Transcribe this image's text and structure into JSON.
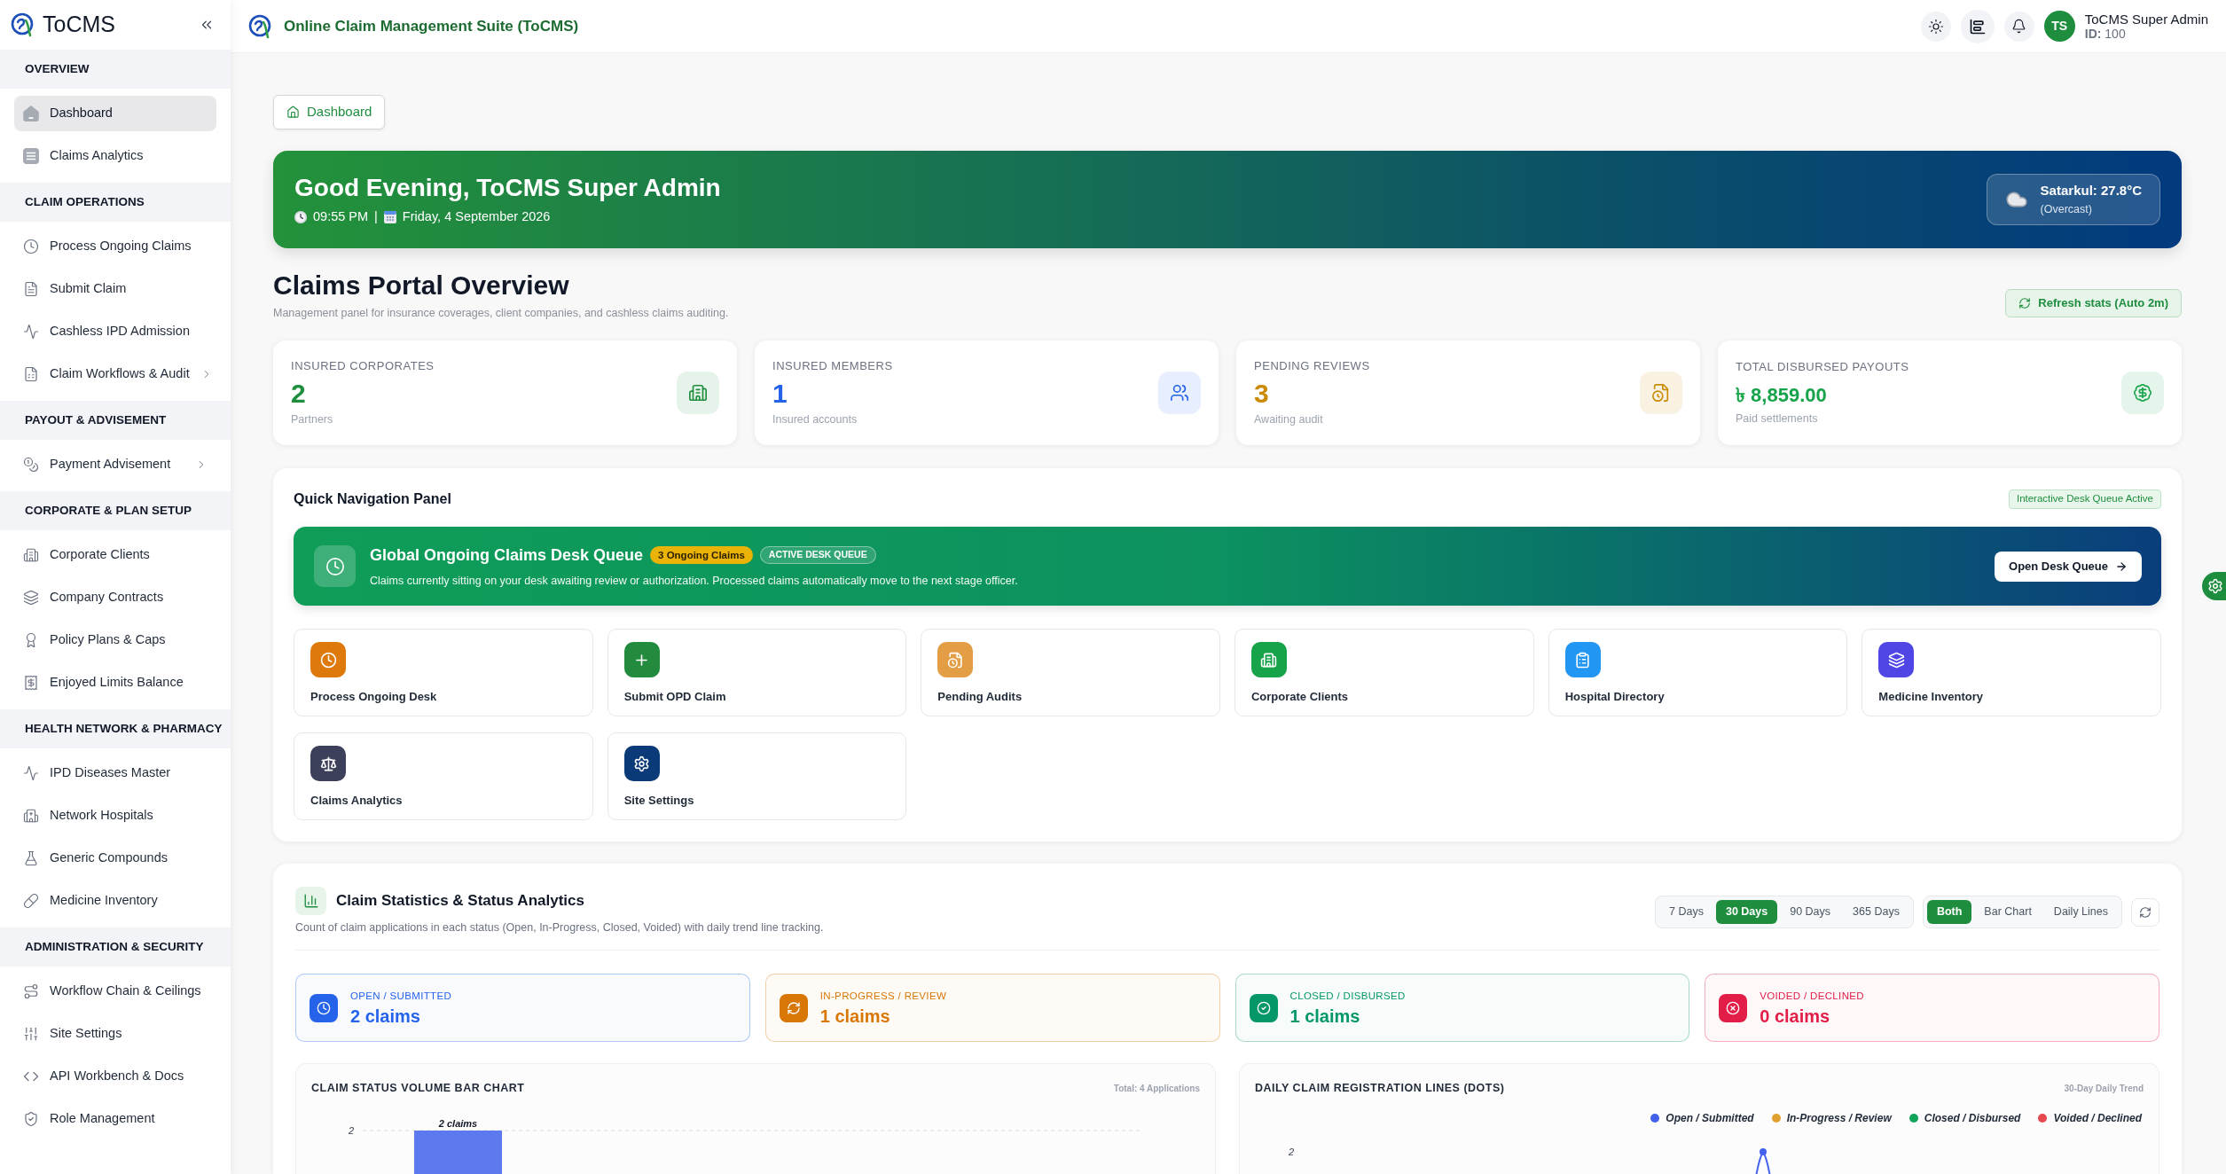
{
  "sidebar": {
    "brand": "ToCMS",
    "sections": [
      {
        "title": "OVERVIEW",
        "items": [
          {
            "label": "Dashboard",
            "selected": true,
            "expandable": false
          },
          {
            "label": "Claims Analytics",
            "selected": false,
            "expandable": false
          }
        ]
      },
      {
        "title": "CLAIM OPERATIONS",
        "items": [
          {
            "label": "Process Ongoing Claims",
            "selected": false,
            "expandable": false
          },
          {
            "label": "Submit Claim",
            "selected": false,
            "expandable": false
          },
          {
            "label": "Cashless IPD Admission",
            "selected": false,
            "expandable": false
          },
          {
            "label": "Claim Workflows & Audit",
            "selected": false,
            "expandable": true
          }
        ]
      },
      {
        "title": "PAYOUT & ADVISEMENT",
        "items": [
          {
            "label": "Payment Advisement",
            "selected": false,
            "expandable": true
          }
        ]
      },
      {
        "title": "CORPORATE & PLAN SETUP",
        "items": [
          {
            "label": "Corporate Clients",
            "selected": false,
            "expandable": false
          },
          {
            "label": "Company Contracts",
            "selected": false,
            "expandable": false
          },
          {
            "label": "Policy Plans & Caps",
            "selected": false,
            "expandable": false
          },
          {
            "label": "Enjoyed Limits Balance",
            "selected": false,
            "expandable": false
          }
        ]
      },
      {
        "title": "HEALTH NETWORK & PHARMACY",
        "items": [
          {
            "label": "IPD Diseases Master",
            "selected": false,
            "expandable": false
          },
          {
            "label": "Network Hospitals",
            "selected": false,
            "expandable": false
          },
          {
            "label": "Generic Compounds",
            "selected": false,
            "expandable": false
          },
          {
            "label": "Medicine Inventory",
            "selected": false,
            "expandable": false
          }
        ]
      },
      {
        "title": "ADMINISTRATION & SECURITY",
        "items": [
          {
            "label": "Workflow Chain & Ceilings",
            "selected": false,
            "expandable": false
          },
          {
            "label": "Site Settings",
            "selected": false,
            "expandable": false
          },
          {
            "label": "API Workbench & Docs",
            "selected": false,
            "expandable": false
          },
          {
            "label": "Role Management",
            "selected": false,
            "expandable": false
          }
        ]
      }
    ]
  },
  "topbar": {
    "title": "Online Claim Management Suite (ToCMS)",
    "user": {
      "initials": "TS",
      "name": "ToCMS Super Admin",
      "id_line": "**ID:** 100"
    }
  },
  "breadcrumb": {
    "label": "Dashboard"
  },
  "greeting": {
    "title": "Good Evening, ToCMS Super Admin",
    "time": "09:55 PM",
    "separator": "|",
    "date": "Friday, 4 September 2026",
    "weather": {
      "reading": "Satarkul: 27.8°C",
      "condition": "(Overcast)"
    }
  },
  "overview": {
    "title": "Claims Portal Overview",
    "subtitle": "Management panel for insurance coverages, client companies, and cashless claims auditing.",
    "refresh_button": "Refresh stats (Auto 2m)"
  },
  "stat_cards": [
    {
      "kind": "count",
      "label": "INSURED CORPORATES",
      "value": "2",
      "note": "Partners",
      "color": "#1e8e3e"
    },
    {
      "kind": "count",
      "label": "INSURED MEMBERS",
      "value": "1",
      "note": "Insured accounts",
      "color": "#2563eb"
    },
    {
      "kind": "count",
      "label": "PENDING REVIEWS",
      "value": "3",
      "note": "Awaiting audit",
      "color": "#ca8a04"
    },
    {
      "kind": "amount",
      "label": "TOTAL DISBURSED PAYOUTS",
      "value": "৳ 8,859.00",
      "note": "Paid settlements",
      "color": "#16a34a"
    }
  ],
  "quick_nav": {
    "title": "Quick Navigation Panel",
    "badge": "Interactive Desk Queue Active",
    "queue": {
      "title": "Global Ongoing Claims Desk Queue",
      "count_badge": "3 Ongoing Claims",
      "state_badge": "ACTIVE DESK QUEUE",
      "description": "Claims currently sitting on your desk awaiting review or authorization. Processed claims automatically move to the next stage officer.",
      "button": "Open Desk Queue"
    },
    "tiles": [
      {
        "label": "Process Ongoing Desk",
        "color": "#dd7a0b"
      },
      {
        "label": "Submit OPD Claim",
        "color": "#238b3d"
      },
      {
        "label": "Pending Audits",
        "color": "#e39d45"
      },
      {
        "label": "Corporate Clients",
        "color": "#17a34a"
      },
      {
        "label": "Hospital Directory",
        "color": "#2196f3"
      },
      {
        "label": "Medicine Inventory",
        "color": "#4f46e5"
      },
      {
        "label": "Claims Analytics",
        "color": "#3d405b"
      },
      {
        "label": "Site Settings",
        "color": "#0b3a78"
      }
    ]
  },
  "statistics": {
    "title": "Claim Statistics & Status Analytics",
    "subtitle": "Count of claim applications in each status (Open, In-Progress, Closed, Voided) with daily trend line tracking.",
    "ranges": [
      {
        "label": "7 Days",
        "selected": false
      },
      {
        "label": "30 Days",
        "selected": true
      },
      {
        "label": "90 Days",
        "selected": false
      },
      {
        "label": "365 Days",
        "selected": false
      }
    ],
    "views": [
      {
        "label": "Both",
        "selected": true
      },
      {
        "label": "Bar Chart",
        "selected": false
      },
      {
        "label": "Daily Lines",
        "selected": false
      }
    ],
    "status_cards": [
      {
        "label": "OPEN / SUBMITTED",
        "value": "2 claims",
        "color": "#2563eb"
      },
      {
        "label": "IN-PROGRESS / REVIEW",
        "value": "1 claims",
        "color": "#d97706"
      },
      {
        "label": "CLOSED / DISBURSED",
        "value": "1 claims",
        "color": "#059669"
      },
      {
        "label": "VOIDED / DECLINED",
        "value": "0 claims",
        "color": "#e11d48"
      }
    ],
    "bar_chart": {
      "title": "CLAIM STATUS VOLUME BAR CHART",
      "caption": "Total: 4 Applications",
      "y_tick": "2",
      "bar_label": "2 claims"
    },
    "line_chart": {
      "title": "DAILY CLAIM REGISTRATION LINES (DOTS)",
      "caption": "30-Day Daily Trend",
      "legend": [
        {
          "label": "Open / Submitted",
          "color": "#4361ee"
        },
        {
          "label": "In-Progress / Review",
          "color": "#e0a030"
        },
        {
          "label": "Closed / Disbursed",
          "color": "#10a35a"
        },
        {
          "label": "Voided / Declined",
          "color": "#e5484d"
        }
      ],
      "y_tick": "2"
    }
  }
}
